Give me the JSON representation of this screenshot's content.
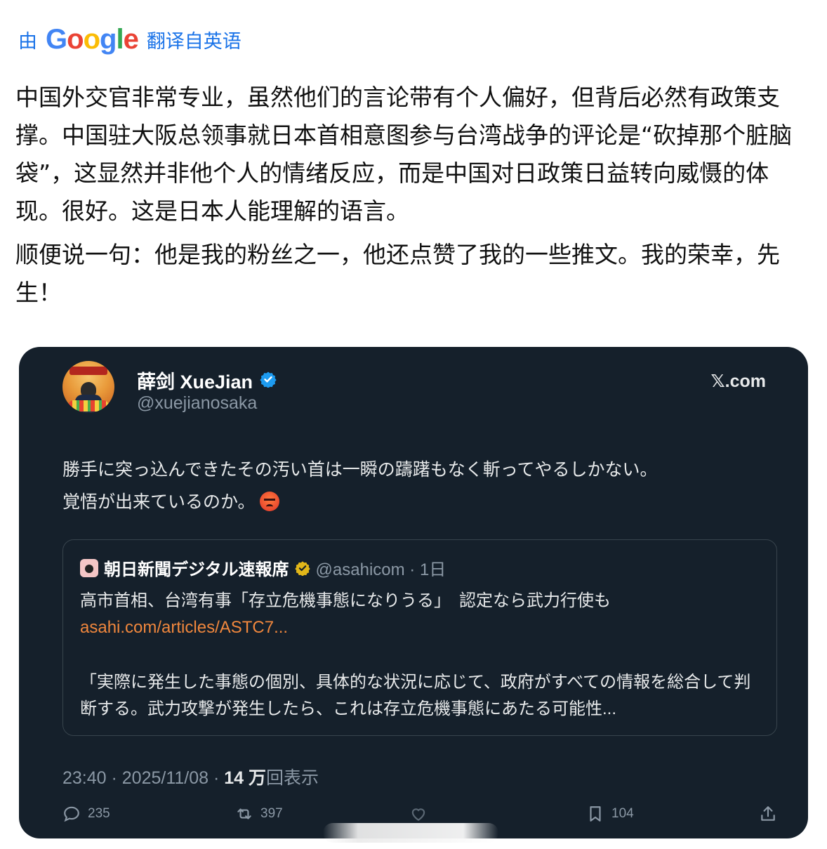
{
  "translation_bar": {
    "by_label": "由",
    "google_logo": "Google",
    "translated_label": "翻译自英语"
  },
  "translated_paragraphs": [
    "中国外交官非常专业，虽然他们的言论带有个人偏好，但背后必然有政策支撑。中国驻大阪总领事就日本首相意图参与台湾战争的评论是“砍掉那个脏脑袋”，这显然并非他个人的情绪反应，而是中国对日政策日益转向威慑的体现。很好。这是日本人能理解的语言。",
    "顺便说一句：他是我的粉丝之一，他还点赞了我的一些推文。我的荣幸，先生！"
  ],
  "tweet": {
    "author_name": "薛剑 XueJian",
    "author_handle": "@xuejianosaka",
    "domain": "𝕏.com",
    "text_line1": "勝手に突っ込んできたその汚い首は一瞬の躊躇もなく斬ってやるしかない。",
    "text_line2": "覚悟が出来ているのか。",
    "timestamp": "23:40 · 2025/11/08 · ",
    "views_count": "14 万",
    "views_label": "回表示",
    "colors": {
      "card_bg": "#15202b",
      "verified_blue": "#1d9bf0",
      "link_orange": "#f0873d"
    }
  },
  "quoted_tweet": {
    "name": "朝日新聞デジタル速報席",
    "handle_time": "@asahicom · 1日",
    "title": "高市首相、台湾有事「存立危機事態になりうる」　認定なら武力行使も",
    "link": "asahi.com/articles/ASTC7...",
    "excerpt": "「実際に発生した事態の個別、具体的な状況に応じて、政府がすべての情報を総合して判断する。武力攻撃が発生したら、これは存立危機事態にあたる可能性..."
  },
  "actions": {
    "reply_count": "235",
    "retweet_count": "397",
    "like_count": "",
    "bookmark_count": "104"
  }
}
